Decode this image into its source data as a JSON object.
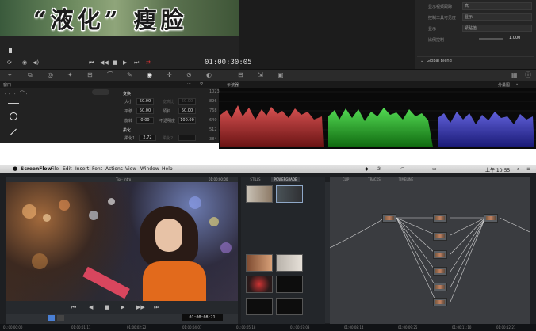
{
  "top": {
    "caption": "“液化” 瘦脸",
    "timecode": "01:00:30:05",
    "inspector": {
      "rows": [
        {
          "label": "显示视频跟踪",
          "value": "高"
        },
        {
          "label": "控制工具可见度",
          "value": "显示"
        },
        {
          "label": "显示",
          "value": "紧贴值"
        }
      ],
      "slider_label": "比例控制",
      "slider_value": "1.000",
      "section": "Global Blend"
    },
    "left_panel": {
      "header": "窗口",
      "transform_title": "变换",
      "fields": [
        {
          "label": "大小",
          "value": "50.00",
          "label2": "宽高比",
          "value2": "50.00"
        },
        {
          "label": "平移",
          "value": "50.00",
          "label2": "倾斜",
          "value2": "50.00"
        },
        {
          "label": "旋转",
          "value": "0.00",
          "label2": "不透明度",
          "value2": "100.00"
        }
      ],
      "soft_title": "柔化",
      "soft_fields": [
        {
          "label": "柔化1",
          "value": "2.72",
          "label2": "柔化2",
          "value2": ""
        }
      ]
    },
    "scope": {
      "header": "示波器",
      "mode": "分量图",
      "y_ticks": [
        "1023",
        "896",
        "768",
        "640",
        "512",
        "384"
      ]
    }
  },
  "bottom": {
    "app_name": "ScreenFlow",
    "menu": [
      "File",
      "Edit",
      "Insert",
      "Font",
      "Actions",
      "View",
      "Window",
      "Help"
    ],
    "clock": "上午 10:55",
    "viewer_timecode": "01:00:08:21",
    "viewer_title": "Tip - Intro",
    "viewer_tc_right": "01:00:00:00",
    "gallery_tabs": [
      "STILLS",
      "POWERGRADE"
    ],
    "node_tabs": [
      "CLIP",
      "TRACKS",
      "TIMELINE"
    ],
    "ruler": [
      "01:00:00:00",
      "01:00:01:11",
      "01:00:02:22",
      "01:00:04:07",
      "01:00:05:18",
      "01:00:07:03",
      "01:00:08:14",
      "01:00:09:25",
      "01:00:11:10",
      "01:00:12:21"
    ]
  }
}
